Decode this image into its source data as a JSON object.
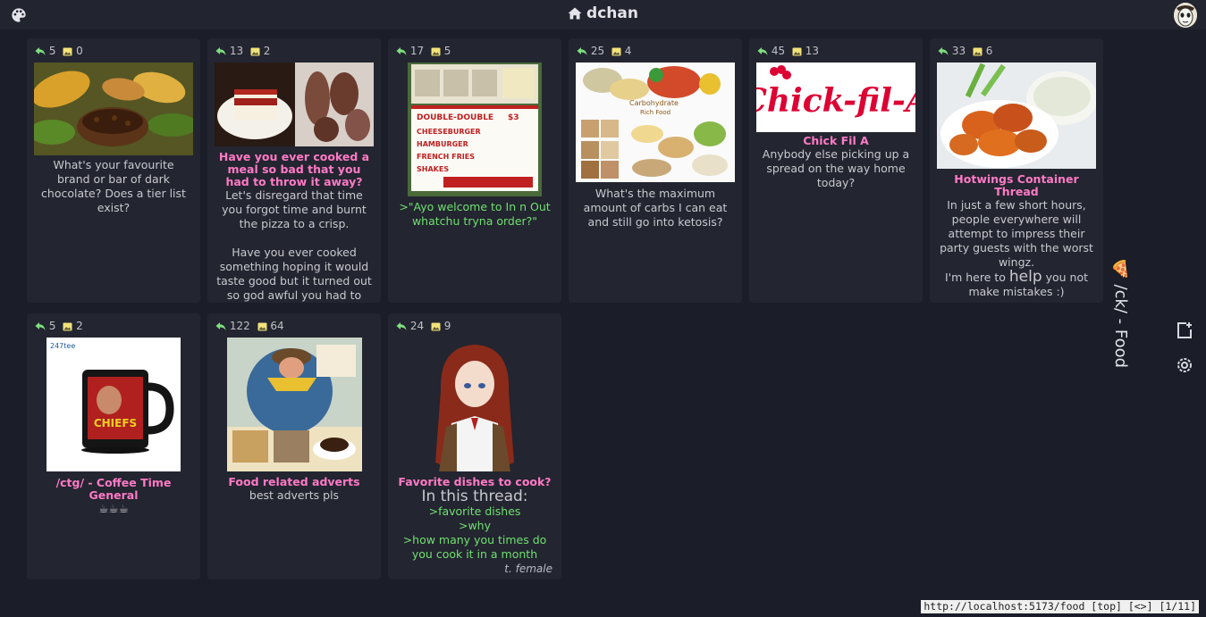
{
  "header": {
    "title": "dchan"
  },
  "board": {
    "label": "/ck/ - Food"
  },
  "threads": [
    {
      "replies": "5",
      "images": "0",
      "subject": "",
      "body": "What's your favourite brand or bar of dark chocolate? Does a tier list exist?",
      "thumb": "cocoa pods and chocolate"
    },
    {
      "replies": "13",
      "images": "2",
      "subject": "Have you ever cooked a meal so bad that you had to throw it away?",
      "body1": "Let's disregard that time you forgot time and burnt the pizza to a crisp.",
      "body2": "Have you ever cooked something hoping it would taste good but it turned out so god awful you had to",
      "thumb": "cake and burnt food"
    },
    {
      "replies": "17",
      "images": "5",
      "subject": "",
      "greentext": ">\"Ayo welcome to In n Out whatchu tryna order?\"",
      "thumb": "In-N-Out menu board"
    },
    {
      "replies": "25",
      "images": "4",
      "subject": "",
      "body": "What's the maximum amount of carbs I can eat and still go into ketosis?",
      "thumb": "carbohydrate rich food chart"
    },
    {
      "replies": "45",
      "images": "13",
      "subject": "Chick Fil A",
      "body": "Anybody else picking up a spread on the way home today?",
      "thumb": "Chick-fil-A logo"
    },
    {
      "replies": "33",
      "images": "6",
      "subject": "Hotwings Container Thread",
      "body1": "In just a few short hours, people everywhere will attempt to impress their party guests with the worst wingz.",
      "body2a": "I'm here to ",
      "body2big": "help",
      "body2b": " you not make mistakes :)",
      "thumb": "hot wings with dip"
    },
    {
      "replies": "5",
      "images": "2",
      "subject": "/ctg/ - Coffee Time General",
      "body": "☕☕☕",
      "thumb": "Chiefs mug",
      "thumb_text": "247tee"
    },
    {
      "replies": "122",
      "images": "64",
      "subject": "Food related adverts",
      "body": "best adverts pls",
      "thumb": "vintage coffee advert"
    },
    {
      "replies": "24",
      "images": "9",
      "subject": "Favorite dishes to cook?",
      "big": "In this thread:",
      "lines": [
        ">favorite dishes",
        ">why",
        ">how many you times do you cook it in a month"
      ],
      "sig": "t. female",
      "thumb": "anime girl"
    }
  ],
  "statusbar": {
    "text": "http://localhost:5173/food [top] [<>] [1/11]"
  },
  "colors": {
    "bg": "#1b1d28",
    "card": "#232530",
    "subject": "#ff7ac6",
    "greentext": "#6fe06f"
  },
  "icons": [
    "palette-icon",
    "home-icon",
    "reply-icon",
    "image-icon",
    "pizza-icon",
    "new-thread-icon",
    "gear-icon"
  ]
}
